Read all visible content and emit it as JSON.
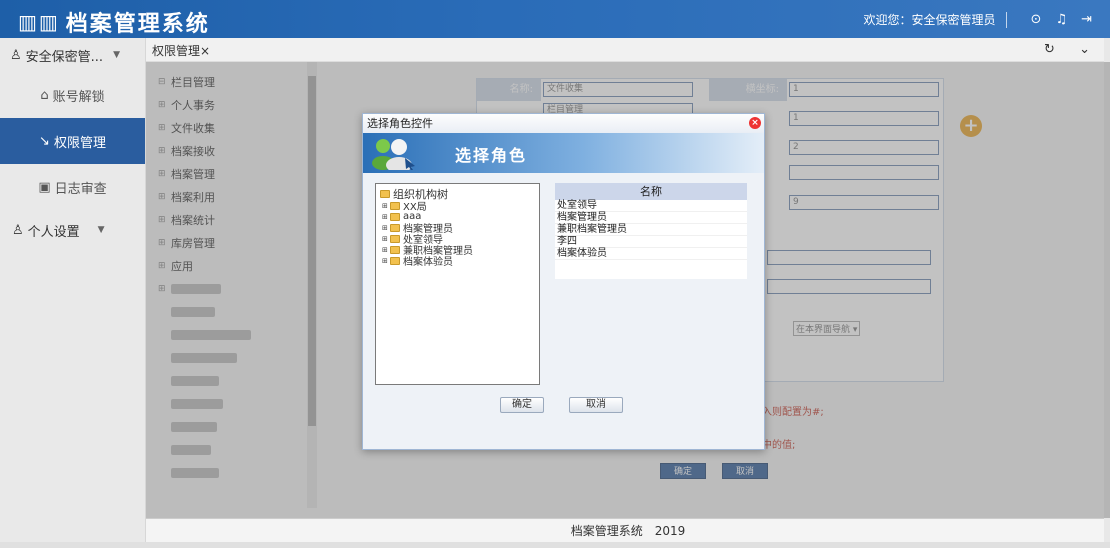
{
  "header": {
    "title": "档案管理系统",
    "welcome": "欢迎您：",
    "user": "安全保密管理员"
  },
  "nav": {
    "top_label": "安全保密管...",
    "items": [
      {
        "label": "账号解锁",
        "icon": "unlock-icon"
      },
      {
        "label": "权限管理",
        "icon": "key-icon"
      },
      {
        "label": "日志审查",
        "icon": "log-icon"
      }
    ],
    "personal": "个人设置"
  },
  "tab": {
    "label": "权限管理×"
  },
  "tree": {
    "root": "栏目管理",
    "items": [
      "个人事务",
      "文件收集",
      "档案接收",
      "档案管理",
      "档案利用",
      "档案统计",
      "库房管理",
      "应用"
    ]
  },
  "form": {
    "name_label": "名称:",
    "name_value": "文件收集",
    "name2_value": "栏目管理",
    "xcoord_label": "横坐标:",
    "xcoord_value": "1",
    "ycoord_value": "1",
    "order_value": "2",
    "field5_value": "",
    "field6_value": "9",
    "select_value": "在本界面导航 ▾",
    "note1": "入则配置为#;",
    "note2": "中的值;",
    "confirm": "确定",
    "cancel": "取消"
  },
  "dialog": {
    "title": "选择角色控件",
    "banner": "选择角色",
    "tree_root": "组织机构树",
    "tree_nodes": [
      "XX局",
      "aaa",
      "档案管理员",
      "处室领导",
      "兼职档案管理员",
      "档案体验员"
    ],
    "list_header": "名称",
    "roles": [
      "处室领导",
      "档案管理员",
      "兼职档案管理员",
      "李四",
      "档案体验员"
    ],
    "ok": "确定",
    "cancel": "取消"
  },
  "footer": {
    "text": "档案管理系统　2019"
  },
  "colors": {
    "header": "#1e5fa8",
    "nav_active": "#2a5d9f",
    "plus": "#e8a329"
  }
}
